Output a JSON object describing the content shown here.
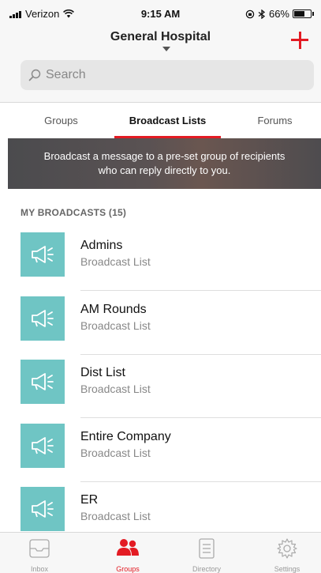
{
  "status_bar": {
    "carrier": "Verizon",
    "time": "9:15 AM",
    "battery": "66%",
    "battery_level": 0.66
  },
  "header": {
    "title": "General Hospital",
    "search_placeholder": "Search"
  },
  "tabs": [
    {
      "label": "Groups",
      "active": false
    },
    {
      "label": "Broadcast Lists",
      "active": true
    },
    {
      "label": "Forums",
      "active": false
    }
  ],
  "banner": {
    "line1": "Broadcast a message to a pre-set group of recipients",
    "line2": "who can reply directly to you."
  },
  "section": {
    "title": "MY BROADCASTS (15)"
  },
  "broadcasts": [
    {
      "name": "Admins",
      "subtitle": "Broadcast List"
    },
    {
      "name": "AM Rounds",
      "subtitle": "Broadcast List"
    },
    {
      "name": "Dist List",
      "subtitle": "Broadcast List"
    },
    {
      "name": "Entire Company",
      "subtitle": "Broadcast List"
    },
    {
      "name": "ER",
      "subtitle": "Broadcast List"
    }
  ],
  "tab_bar": [
    {
      "label": "Inbox",
      "icon": "inbox-icon",
      "active": false
    },
    {
      "label": "Groups",
      "icon": "groups-icon",
      "active": true
    },
    {
      "label": "Directory",
      "icon": "directory-icon",
      "active": false
    },
    {
      "label": "Settings",
      "icon": "settings-icon",
      "active": false
    }
  ],
  "colors": {
    "accent": "#e31b23",
    "tile": "#6fc5c4"
  }
}
